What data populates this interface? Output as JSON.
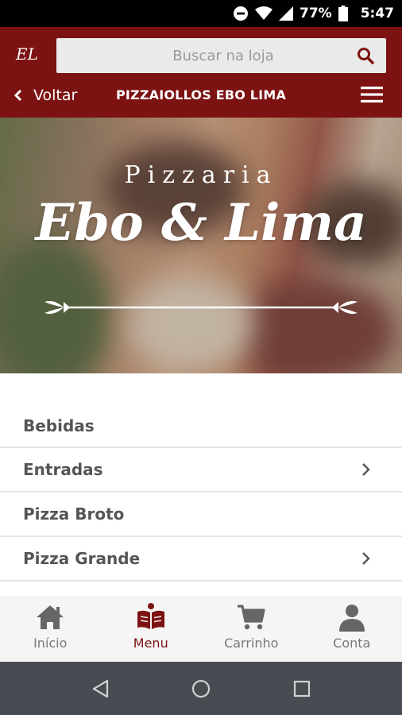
{
  "status_bar": {
    "battery_percent": "77%",
    "time": "5:47",
    "icons": [
      "do-not-disturb-icon",
      "wifi-icon",
      "signal-icon",
      "battery-icon"
    ]
  },
  "header": {
    "logo_text": "EL",
    "search": {
      "placeholder": "Buscar na loja"
    },
    "back_label": "Voltar",
    "store_title": "PIZZAIOLLOS EBO LIMA"
  },
  "hero": {
    "subtitle": "Pizzaria",
    "title": "Ebo & Lima"
  },
  "categories": [
    {
      "label": "Bebidas",
      "has_chevron": false
    },
    {
      "label": "Entradas",
      "has_chevron": true
    },
    {
      "label": "Pizza Broto",
      "has_chevron": false
    },
    {
      "label": "Pizza Grande",
      "has_chevron": true
    }
  ],
  "tabs": [
    {
      "label": "Início",
      "icon": "home-icon",
      "active": false
    },
    {
      "label": "Menu",
      "icon": "book-icon",
      "active": true
    },
    {
      "label": "Carrinho",
      "icon": "cart-icon",
      "active": false
    },
    {
      "label": "Conta",
      "icon": "user-icon",
      "active": false
    }
  ],
  "colors": {
    "brand": "#7c1211",
    "tab_bar": "#f5f5f5",
    "nav_bar": "#464c52"
  }
}
